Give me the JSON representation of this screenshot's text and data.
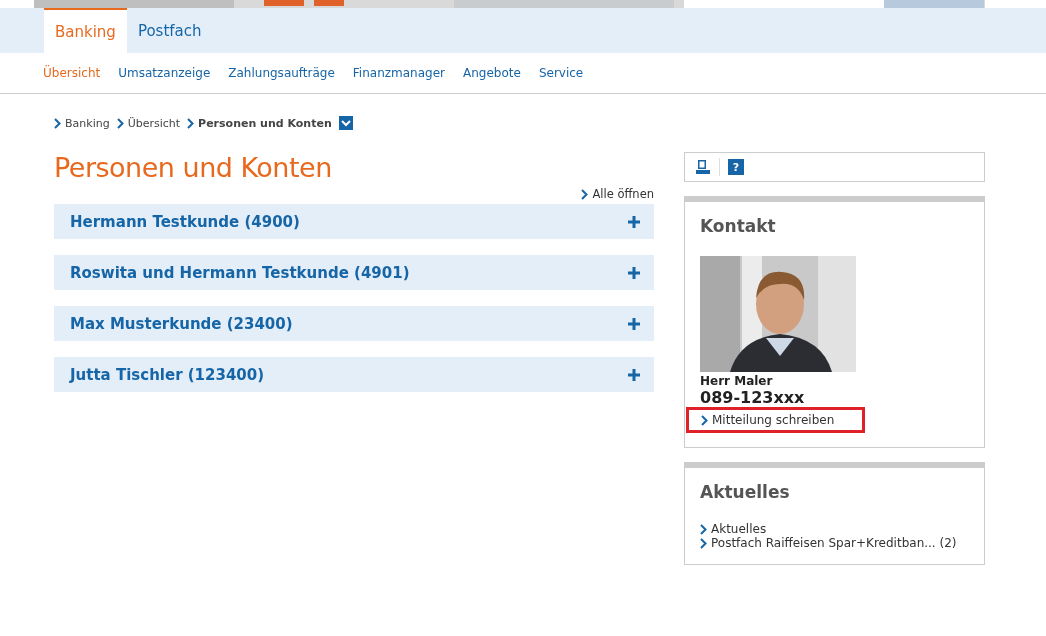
{
  "tabs": [
    {
      "label": "Banking",
      "selected": true
    },
    {
      "label": "Postfach",
      "selected": false
    }
  ],
  "subnav": [
    {
      "label": "Übersicht",
      "selected": true
    },
    {
      "label": "Umsatzanzeige",
      "selected": false
    },
    {
      "label": "Zahlungsaufträge",
      "selected": false
    },
    {
      "label": "Finanzmanager",
      "selected": false
    },
    {
      "label": "Angebote",
      "selected": false
    },
    {
      "label": "Service",
      "selected": false
    }
  ],
  "breadcrumb": [
    {
      "label": "Banking",
      "current": false
    },
    {
      "label": "Übersicht",
      "current": false
    },
    {
      "label": "Personen und Konten",
      "current": true
    }
  ],
  "page_title": "Personen und Konten",
  "open_all": "Alle öffnen",
  "accordion": [
    {
      "label": "Hermann Testkunde (4900)",
      "expanded": false
    },
    {
      "label": "Roswita und Hermann Testkunde (4901)",
      "expanded": false
    },
    {
      "label": "Max Musterkunde (23400)",
      "expanded": false
    },
    {
      "label": "Jutta Tischler (123400)",
      "expanded": false
    }
  ],
  "toolbar": {
    "help": "?"
  },
  "contact": {
    "title": "Kontakt",
    "name": "Herr Maler",
    "phone": "089-123xxx",
    "link": "Mitteilung schreiben",
    "highlighted": true
  },
  "news": {
    "title": "Aktuelles",
    "links": [
      "Aktuelles",
      "Postfach Raiffeisen Spar+Kreditban... (2)"
    ]
  }
}
